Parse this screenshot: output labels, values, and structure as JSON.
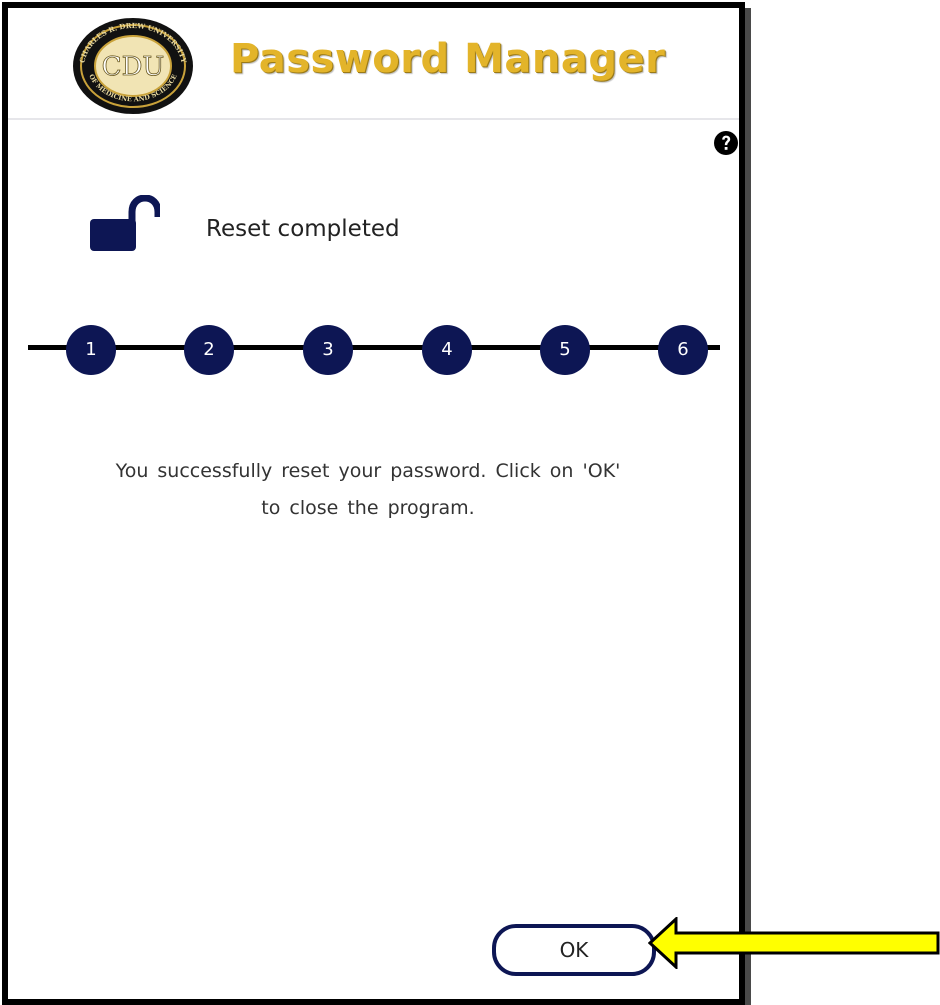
{
  "header": {
    "title": "Password Manager",
    "logo": {
      "center_text": "CDU",
      "ring_text_top": "CHARLES R. DREW UNIVERSITY",
      "ring_text_bottom": "OF MEDICINE AND SCIENCE"
    }
  },
  "icons": {
    "help": "question-circle-icon",
    "lock": "unlocked-padlock-icon",
    "annotation": "yellow-arrow-pointer"
  },
  "status": {
    "label": "Reset completed"
  },
  "steps": [
    "1",
    "2",
    "3",
    "4",
    "5",
    "6"
  ],
  "message": {
    "line1": "You successfully reset your password. Click on 'OK'",
    "line2": "to close the program."
  },
  "actions": {
    "ok_label": "OK"
  },
  "colors": {
    "navy": "#0d1654",
    "gold": "#e3b42a",
    "arrow_yellow": "#ffff00"
  }
}
